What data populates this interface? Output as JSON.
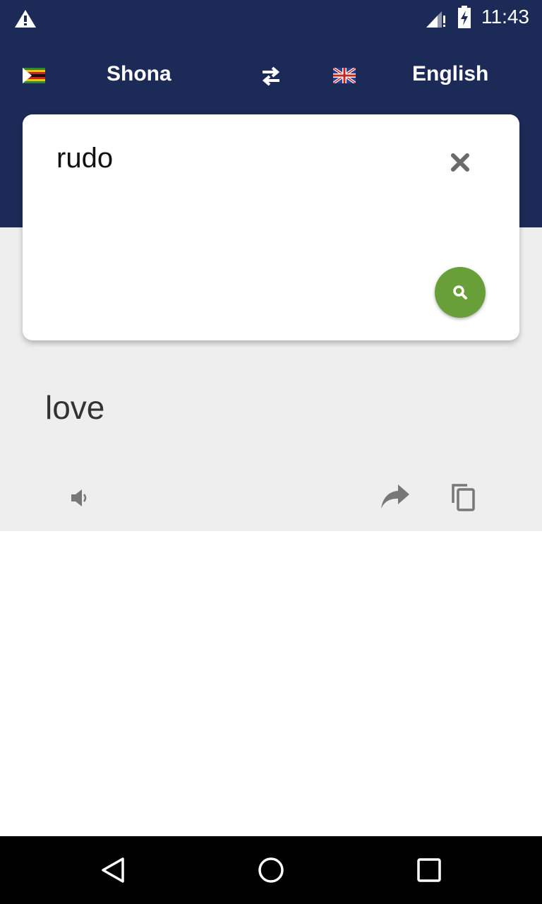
{
  "status_bar": {
    "time": "11:43",
    "icons": [
      "warning-icon",
      "signal-icon",
      "battery-charging-icon"
    ]
  },
  "header": {
    "source_language": "Shona",
    "target_language": "English",
    "source_flag": "zimbabwe-flag",
    "target_flag": "uk-flag",
    "swap_icon": "swap-icon"
  },
  "input": {
    "value": "rudo",
    "clear_icon": "close-icon",
    "search_icon": "search-icon"
  },
  "result": {
    "text": "love",
    "actions": [
      "speaker-icon",
      "share-icon",
      "copy-icon"
    ]
  },
  "colors": {
    "primary": "#1c2a57",
    "accent": "#689f38",
    "background": "#eeeeee"
  }
}
